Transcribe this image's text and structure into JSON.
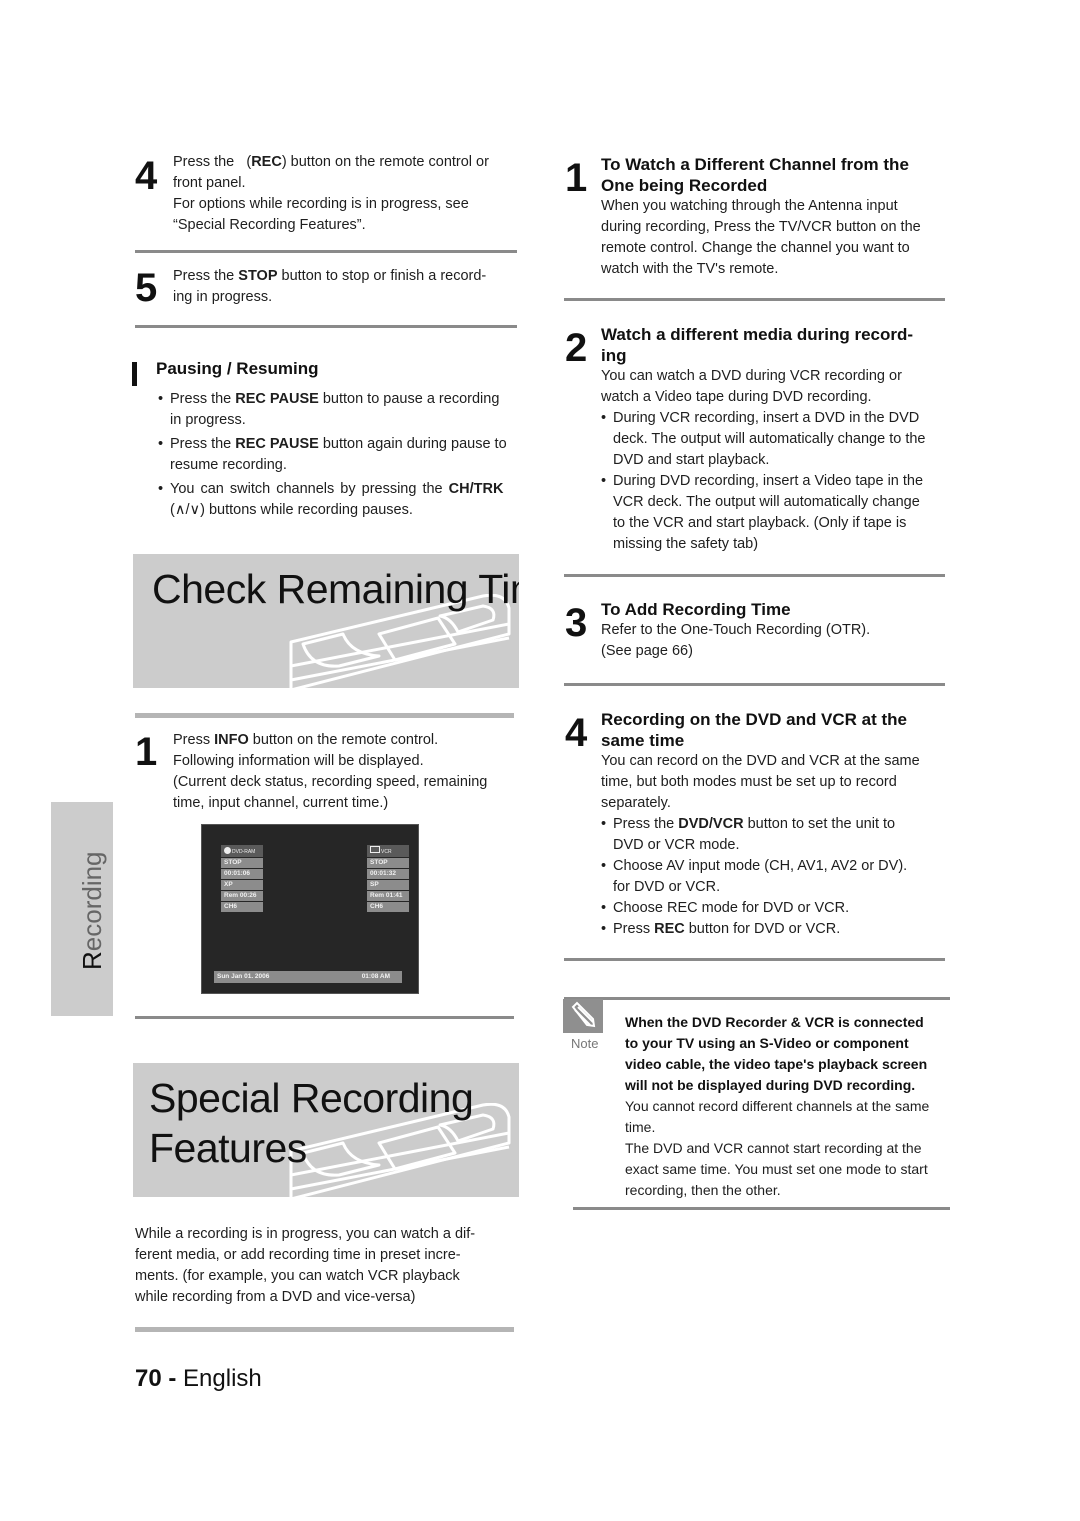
{
  "left": {
    "step4": {
      "number": "4",
      "line1_pre": "Press the",
      "line1_bold": "REC",
      "line1_post": ") button on the remote control or",
      "line1_open": "(",
      "line2": "front panel.",
      "line3": "For options while recording is in progress, see",
      "line4": "“Special Recording Features”."
    },
    "step5": {
      "number": "5",
      "line1_pre": "Press the ",
      "line1_bold": "STOP",
      "line1_post": " button to stop or finish a record-",
      "line2": "ing in progress."
    },
    "pausing": {
      "title": "Pausing / Resuming",
      "bullets": [
        {
          "pre": "Press the ",
          "bold": "REC PAUSE",
          "post": " button to pause a recording",
          "line2": "in progress."
        },
        {
          "pre": "Press the ",
          "bold": "REC PAUSE",
          "post": " button again during pause to",
          "line2": "resume recording."
        },
        {
          "pre": "You can switch channels by pressing the ",
          "bold": "CH/TRK",
          "post": "",
          "line2": "(∧/∨) buttons while recording pauses."
        }
      ]
    },
    "check_banner": {
      "title": "Check Remaining Time"
    },
    "info_step": {
      "number": "1",
      "line1_pre": "Press ",
      "line1_bold": "INFO",
      "line1_post": " button on the remote control.",
      "line2": "Following information will be displayed.",
      "line3": "(Current deck status, recording speed, remaining",
      "line4": " time, input channel, current time.)"
    },
    "osd": {
      "dvd": {
        "header": "DVD-RAM",
        "rows": [
          "STOP",
          "00:01:06",
          "XP",
          "Rem 00:26",
          "CH6"
        ]
      },
      "vcr": {
        "header": "VCR",
        "rows": [
          "STOP",
          "00:01:32",
          "SP",
          "Rem 01:41",
          "CH6"
        ]
      },
      "date": "Sun Jan 01. 2006",
      "time": "01:08 AM"
    },
    "special_banner": {
      "title_line1": "Special Recording",
      "title_line2": "Features"
    },
    "intro": [
      "While a recording is in progress, you can watch a dif-",
      "ferent media, or add recording time in preset incre-",
      "ments. (for example, you can watch VCR playback",
      "while recording from a DVD and vice-versa)"
    ],
    "footer": {
      "page": "70 -",
      "language": "English"
    }
  },
  "side_tab": {
    "label_first": "R",
    "label_rest": "ecording"
  },
  "right": {
    "sec1": {
      "number": "1",
      "title_line1": "To Watch a Different Channel from the",
      "title_line2": "One being Recorded",
      "lines": [
        "When you watching through the Antenna input",
        "during recording, Press the TV/VCR button on the",
        "remote control. Change the channel you want to",
        "watch with the TV's remote."
      ]
    },
    "sec2": {
      "number": "2",
      "title_line1": "Watch a different media during record-",
      "title_line2": "ing",
      "lines": [
        "You can watch a DVD during VCR recording or",
        "watch a Video tape during DVD recording."
      ],
      "bullets": [
        [
          "During VCR recording, insert a DVD in the DVD",
          "deck. The output will automatically change to the",
          "DVD and start playback."
        ],
        [
          "During DVD recording, insert a Video tape in the",
          "VCR deck. The output will automatically change",
          "to the VCR and start playback. (Only if tape is",
          "missing the safety tab)"
        ]
      ]
    },
    "sec3": {
      "number": "3",
      "title": "To Add Recording Time",
      "lines": [
        "Refer to the One-Touch Recording (OTR).",
        "(See page 66)"
      ]
    },
    "sec4": {
      "number": "4",
      "title_line1": "Recording on the DVD and VCR at the",
      "title_line2": "same time",
      "lines": [
        "You can record on the DVD and VCR at the same",
        "time, but both modes must be set up to record",
        "separately."
      ],
      "bullet1": {
        "pre": "Press the ",
        "bold": "DVD/VCR",
        "post": " button to set the unit to",
        "line2": "DVD or VCR mode."
      },
      "bullet2": {
        "line1": "Choose AV input mode (CH, AV1, AV2 or DV).",
        "line2": "for DVD or VCR."
      },
      "bullet3": {
        "line1": "Choose REC mode for DVD or VCR."
      },
      "bullet4": {
        "pre": "Press ",
        "bold": "REC",
        "post": " button for DVD or VCR."
      }
    },
    "note": {
      "label": "Note",
      "bold_lines": [
        "When the DVD Recorder & VCR is connected",
        "to your TV using an S-Video or component",
        "video cable, the video tape's playback screen",
        "will not be displayed during DVD recording."
      ],
      "lines": [
        "You cannot record different channels at the same",
        " time.",
        "The DVD and VCR cannot start recording at the",
        "exact same time. You must set one mode to start",
        "recording, then the other."
      ]
    }
  }
}
